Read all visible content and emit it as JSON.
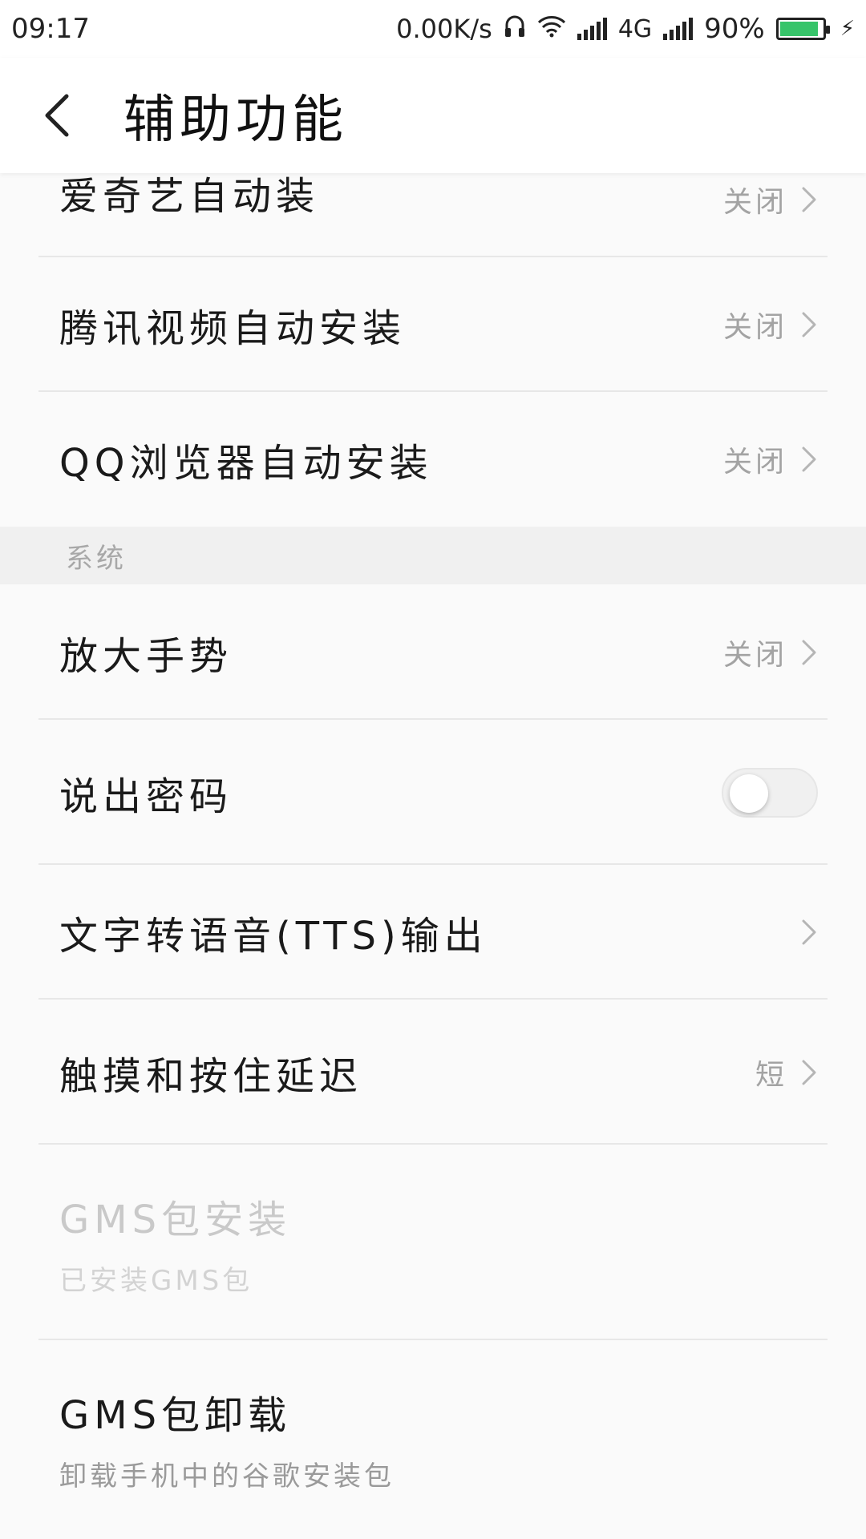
{
  "status_bar": {
    "time": "09:17",
    "net_speed": "0.00K/s",
    "network": "4G",
    "battery": "90%",
    "battery_level": 0.9,
    "battery_color": "#37c46a"
  },
  "header": {
    "title": "辅助功能",
    "back_icon": "chevron-left-icon"
  },
  "items_top": [
    {
      "title": "爱奇艺自动装",
      "value": "关闭"
    },
    {
      "title": "腾讯视频自动安装",
      "value": "关闭"
    },
    {
      "title": "QQ浏览器自动安装",
      "value": "关闭"
    }
  ],
  "section": {
    "label": "系统"
  },
  "items_system": {
    "magnify": {
      "title": "放大手势",
      "value": "关闭"
    },
    "speak_password": {
      "title": "说出密码",
      "toggle_on": false
    },
    "tts": {
      "title": "文字转语音(TTS)输出"
    },
    "touch_delay": {
      "title": "触摸和按住延迟",
      "value": "短"
    },
    "gms_install": {
      "title": "GMS包安装",
      "subtitle": "已安装GMS包"
    },
    "gms_uninstall": {
      "title": "GMS包卸载",
      "subtitle": "卸载手机中的谷歌安装包"
    }
  }
}
